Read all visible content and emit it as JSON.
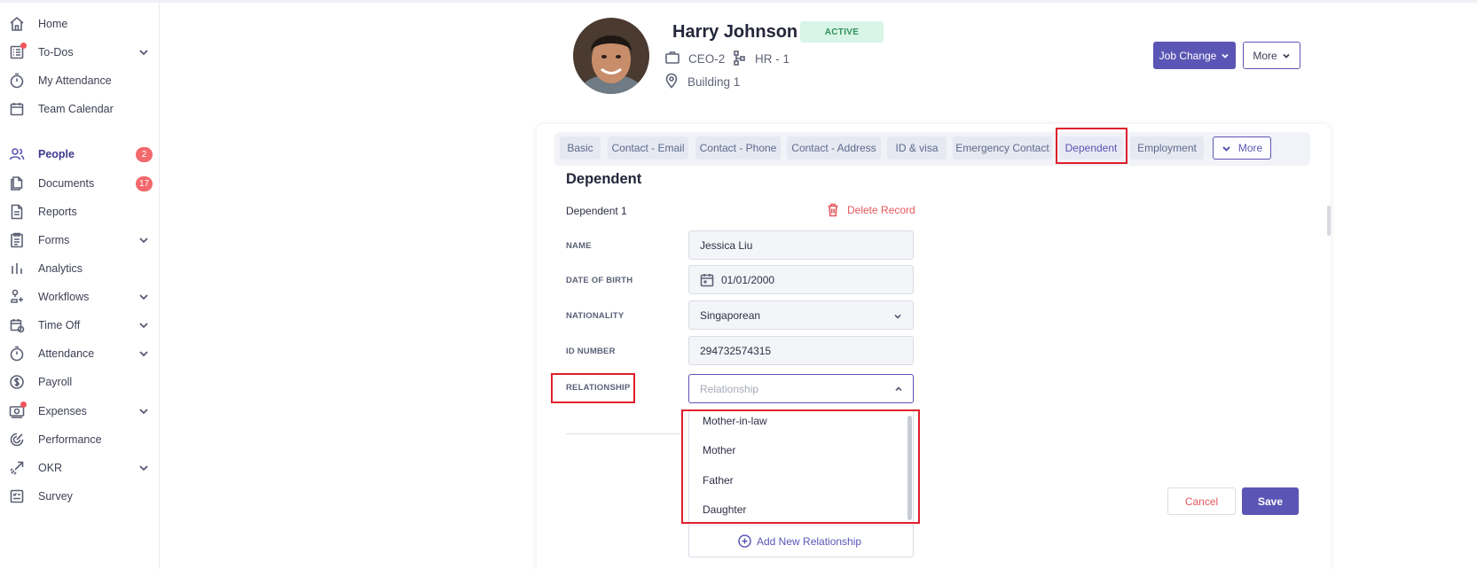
{
  "sidebar": {
    "items": [
      {
        "label": "Home",
        "icon": "home-icon"
      },
      {
        "label": "To-Dos",
        "icon": "todo-list-icon"
      },
      {
        "label": "My Attendance",
        "icon": "stopwatch-icon"
      },
      {
        "label": "Team Calendar",
        "icon": "calendar-icon"
      },
      {
        "label": "People",
        "icon": "people-icon",
        "badge": "2"
      },
      {
        "label": "Documents",
        "icon": "documents-icon",
        "badge": "17"
      },
      {
        "label": "Reports",
        "icon": "report-icon"
      },
      {
        "label": "Forms",
        "icon": "form-icon"
      },
      {
        "label": "Analytics",
        "icon": "bar-chart-icon"
      },
      {
        "label": "Workflows",
        "icon": "workflow-icon"
      },
      {
        "label": "Time Off",
        "icon": "time-off-icon"
      },
      {
        "label": "Attendance",
        "icon": "stopwatch-icon"
      },
      {
        "label": "Payroll",
        "icon": "dollar-icon"
      },
      {
        "label": "Expenses",
        "icon": "wallet-icon"
      },
      {
        "label": "Performance",
        "icon": "target-icon"
      },
      {
        "label": "OKR",
        "icon": "rocket-icon"
      },
      {
        "label": "Survey",
        "icon": "survey-icon"
      }
    ]
  },
  "employee": {
    "name": "Harry Johnson",
    "status": "ACTIVE",
    "position": "CEO-2",
    "department": "HR - 1",
    "location": "Building 1"
  },
  "header_actions": {
    "job_change": "Job Change",
    "more": "More"
  },
  "tabs": [
    {
      "label": "Basic"
    },
    {
      "label": "Contact - Email"
    },
    {
      "label": "Contact - Phone"
    },
    {
      "label": "Contact - Address"
    },
    {
      "label": "ID & visa"
    },
    {
      "label": "Emergency Contact"
    },
    {
      "label": "Dependent"
    },
    {
      "label": "Employment"
    }
  ],
  "tab_more": "More",
  "section": {
    "title": "Dependent",
    "record_title": "Dependent 1",
    "delete_label": "Delete Record"
  },
  "form": {
    "name_label": "NAME",
    "name_value": "Jessica Liu",
    "dob_label": "DATE OF BIRTH",
    "dob_value": "01/01/2000",
    "nationality_label": "NATIONALITY",
    "nationality_value": "Singaporean",
    "id_label": "ID NUMBER",
    "id_value": "294732574315",
    "relationship_label": "RELATIONSHIP",
    "relationship_placeholder": "Relationship"
  },
  "relationship_options": [
    "Mother-in-law",
    "Mother",
    "Father",
    "Daughter"
  ],
  "add_relationship": "Add New Relationship",
  "actions": {
    "cancel": "Cancel",
    "save": "Save"
  },
  "colors": {
    "accent": "#5b55b5",
    "danger": "#e4575d",
    "status_bg": "#d8f5e7",
    "highlight": "#e01e2b"
  }
}
